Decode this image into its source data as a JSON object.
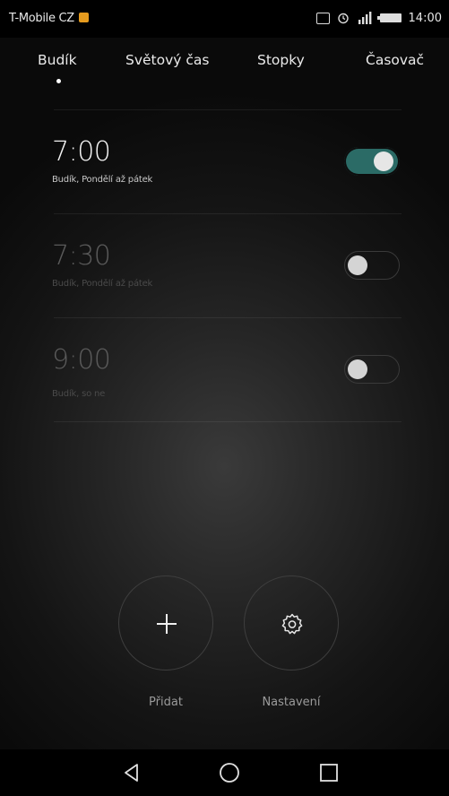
{
  "status_bar": {
    "carrier": "T-Mobile CZ",
    "time": "14:00",
    "icons": [
      "notification-badge-icon",
      "nfc-icon",
      "alarm-clock-icon",
      "signal-icon",
      "battery-icon"
    ]
  },
  "tabs": [
    {
      "label": "Budík",
      "active": true
    },
    {
      "label": "Světový čas",
      "active": false
    },
    {
      "label": "Stopky",
      "active": false
    },
    {
      "label": "Časovač",
      "active": false
    }
  ],
  "alarms": [
    {
      "time": "7:00",
      "description": "Budík, Pondělí až pátek",
      "enabled": true
    },
    {
      "time": "7:30",
      "description": "Budík, Pondělí až pátek",
      "enabled": false
    },
    {
      "time": "9:00",
      "description": "Budík, so ne",
      "enabled": false
    }
  ],
  "actions": {
    "add_label": "Přidat",
    "settings_label": "Nastavení"
  },
  "colors": {
    "toggle_on": "#2b6b66",
    "carrier_badge": "#e69b1e"
  },
  "nav": [
    "back-icon",
    "home-icon",
    "recents-icon"
  ]
}
